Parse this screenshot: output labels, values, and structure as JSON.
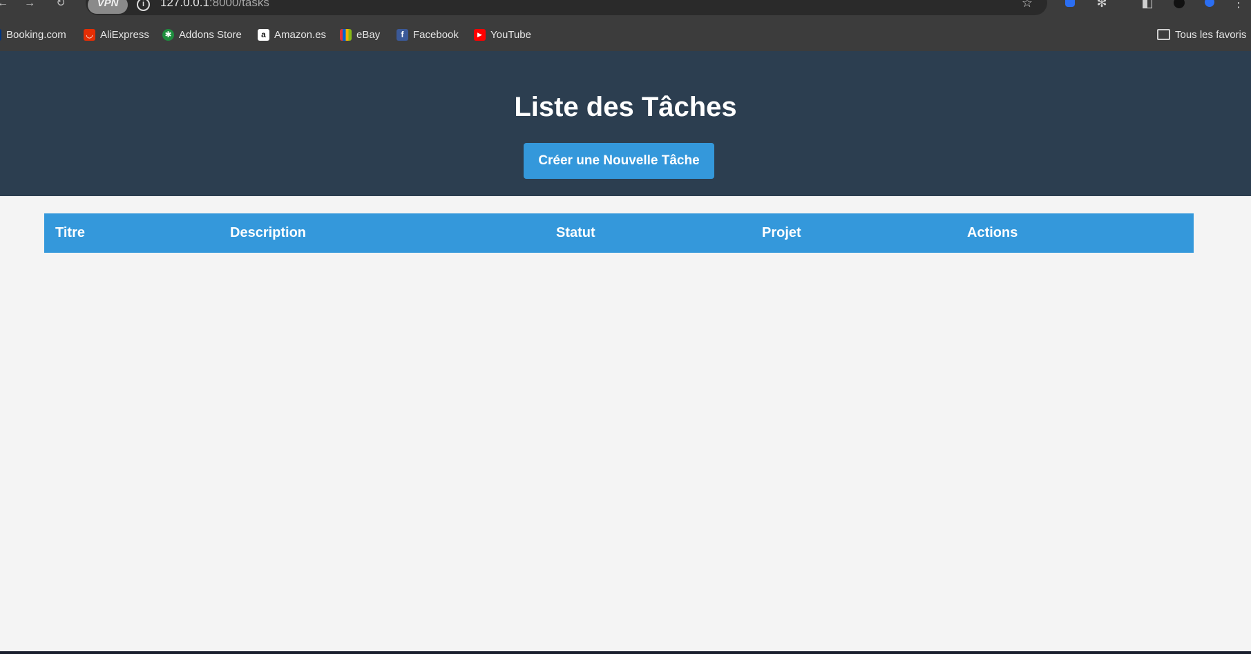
{
  "browser": {
    "vpn_label": "VPN",
    "url_host": "127.0.0.1",
    "url_rest": ":8000/tasks",
    "icons": [
      "back-icon",
      "forward-icon",
      "reload-icon",
      "info-icon",
      "star-icon",
      "extension-icon",
      "puzzle-icon",
      "sidepanel-icon",
      "profile-icon",
      "shield-icon",
      "menu-icon"
    ]
  },
  "bookmarks": {
    "items": [
      {
        "label": "Booking.com",
        "icon": "booking-icon",
        "color": "#003580"
      },
      {
        "label": "AliExpress",
        "icon": "aliexpress-icon",
        "color": "#e62e04"
      },
      {
        "label": "Addons Store",
        "icon": "addons-icon",
        "color": "#1e8e3e"
      },
      {
        "label": "Amazon.es",
        "icon": "amazon-icon",
        "color": "#ffffff"
      },
      {
        "label": "eBay",
        "icon": "ebay-icon",
        "color": "#e53238"
      },
      {
        "label": "Facebook",
        "icon": "facebook-icon",
        "color": "#3b5998"
      },
      {
        "label": "YouTube",
        "icon": "youtube-icon",
        "color": "#ff0000"
      }
    ],
    "all_favorites": "Tous les favoris"
  },
  "header": {
    "title": "Liste des Tâches",
    "create_button": "Créer une Nouvelle Tâche"
  },
  "table": {
    "columns": [
      "Titre",
      "Description",
      "Statut",
      "Projet",
      "Actions"
    ],
    "rows": []
  },
  "colors": {
    "header_bg": "#2c3e50",
    "accent": "#3498db",
    "page_bg": "#f4f4f4"
  }
}
